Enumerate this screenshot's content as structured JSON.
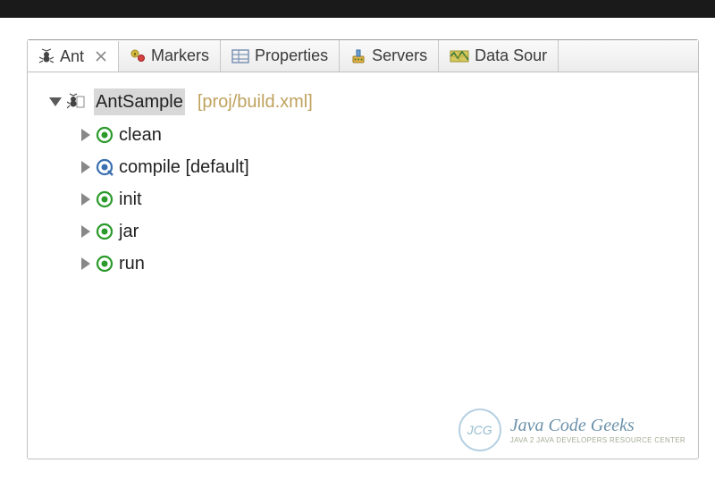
{
  "tabs": [
    {
      "label": "Ant",
      "icon": "ant-icon",
      "active": true,
      "closable": true
    },
    {
      "label": "Markers",
      "icon": "markers-icon",
      "active": false,
      "closable": false
    },
    {
      "label": "Properties",
      "icon": "properties-icon",
      "active": false,
      "closable": false
    },
    {
      "label": "Servers",
      "icon": "servers-icon",
      "active": false,
      "closable": false
    },
    {
      "label": "Data Sour",
      "icon": "data-source-icon",
      "active": false,
      "closable": false
    }
  ],
  "tree": {
    "root": {
      "name": "AntSample",
      "path": "[proj/build.xml]"
    },
    "targets": [
      {
        "name": "clean",
        "default": false
      },
      {
        "name": "compile [default]",
        "default": true
      },
      {
        "name": "init",
        "default": false
      },
      {
        "name": "jar",
        "default": false
      },
      {
        "name": "run",
        "default": false
      }
    ]
  },
  "watermark": {
    "circle": "JCG",
    "title": "Java Code Geeks",
    "subtitle": "Java 2 Java Developers Resource Center"
  }
}
